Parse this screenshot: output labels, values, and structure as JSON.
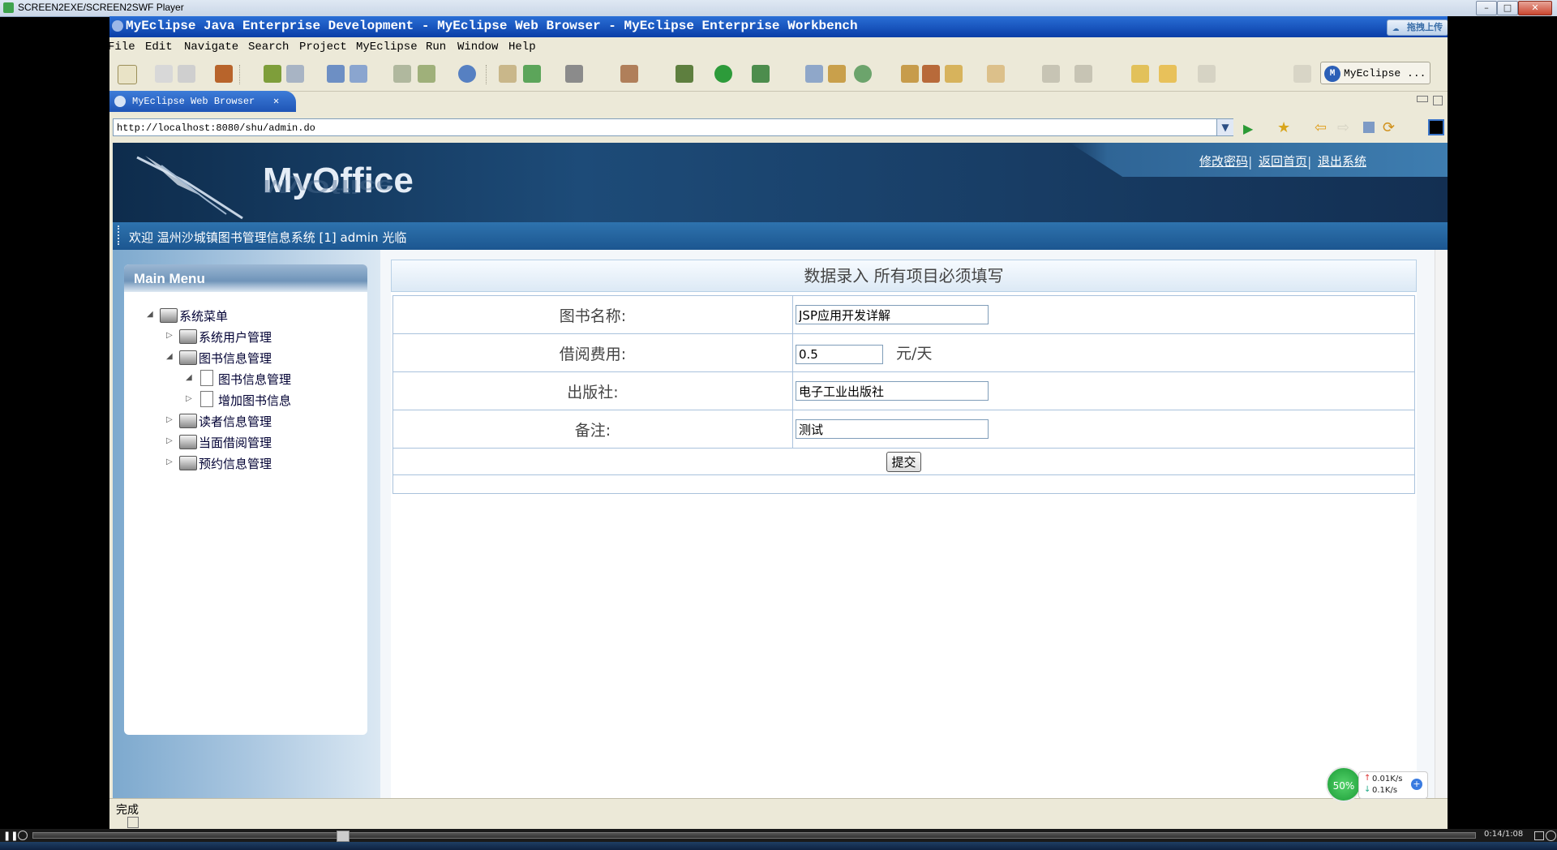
{
  "player": {
    "title": "SCREEN2EXE/SCREEN2SWF Player",
    "timecode": "0:14/1:08"
  },
  "eclipse": {
    "title": "MyEclipse Java Enterprise Development - MyEclipse Web Browser - MyEclipse Enterprise Workbench",
    "upload_label": "拖拽上传",
    "menu": [
      "File",
      "Edit",
      "Navigate",
      "Search",
      "Project",
      "MyEclipse",
      "Run",
      "Window",
      "Help"
    ],
    "perspective_label": "MyEclipse ...",
    "tab_label": "MyEclipse Web Browser",
    "address": "http://localhost:8080/shu/admin.do",
    "status": "完成"
  },
  "site": {
    "logo": "MyOffice",
    "top_links": [
      "修改密码",
      "返回首页",
      "退出系统"
    ],
    "welcome": "欢迎 温州沙城镇图书管理信息系统 [1] admin 光临",
    "main_menu_title": "Main Menu",
    "tree": [
      {
        "label": "系统菜单",
        "level": 0,
        "expanded": true,
        "type": "folder"
      },
      {
        "label": "系统用户管理",
        "level": 1,
        "expanded": false,
        "type": "folder"
      },
      {
        "label": "图书信息管理",
        "level": 1,
        "expanded": true,
        "type": "folder"
      },
      {
        "label": "图书信息管理",
        "level": 2,
        "expanded": true,
        "type": "doc"
      },
      {
        "label": "增加图书信息",
        "level": 2,
        "expanded": false,
        "type": "doc"
      },
      {
        "label": "读者信息管理",
        "level": 1,
        "expanded": false,
        "type": "folder"
      },
      {
        "label": "当面借阅管理",
        "level": 1,
        "expanded": false,
        "type": "folder"
      },
      {
        "label": "预约信息管理",
        "level": 1,
        "expanded": false,
        "type": "folder"
      }
    ]
  },
  "form": {
    "header": "数据录入 所有项目必须填写",
    "book_name_label": "图书名称:",
    "book_name_value": "JSP应用开发详解",
    "fee_label": "借阅费用:",
    "fee_value": "0.5",
    "fee_unit": "元/天",
    "publisher_label": "出版社:",
    "publisher_value": "电子工业出版社",
    "remark_label": "备注:",
    "remark_value": "测试",
    "submit_label": "提交"
  },
  "net": {
    "percent": "50%",
    "up": "0.01K/s",
    "down": "0.1K/s"
  }
}
